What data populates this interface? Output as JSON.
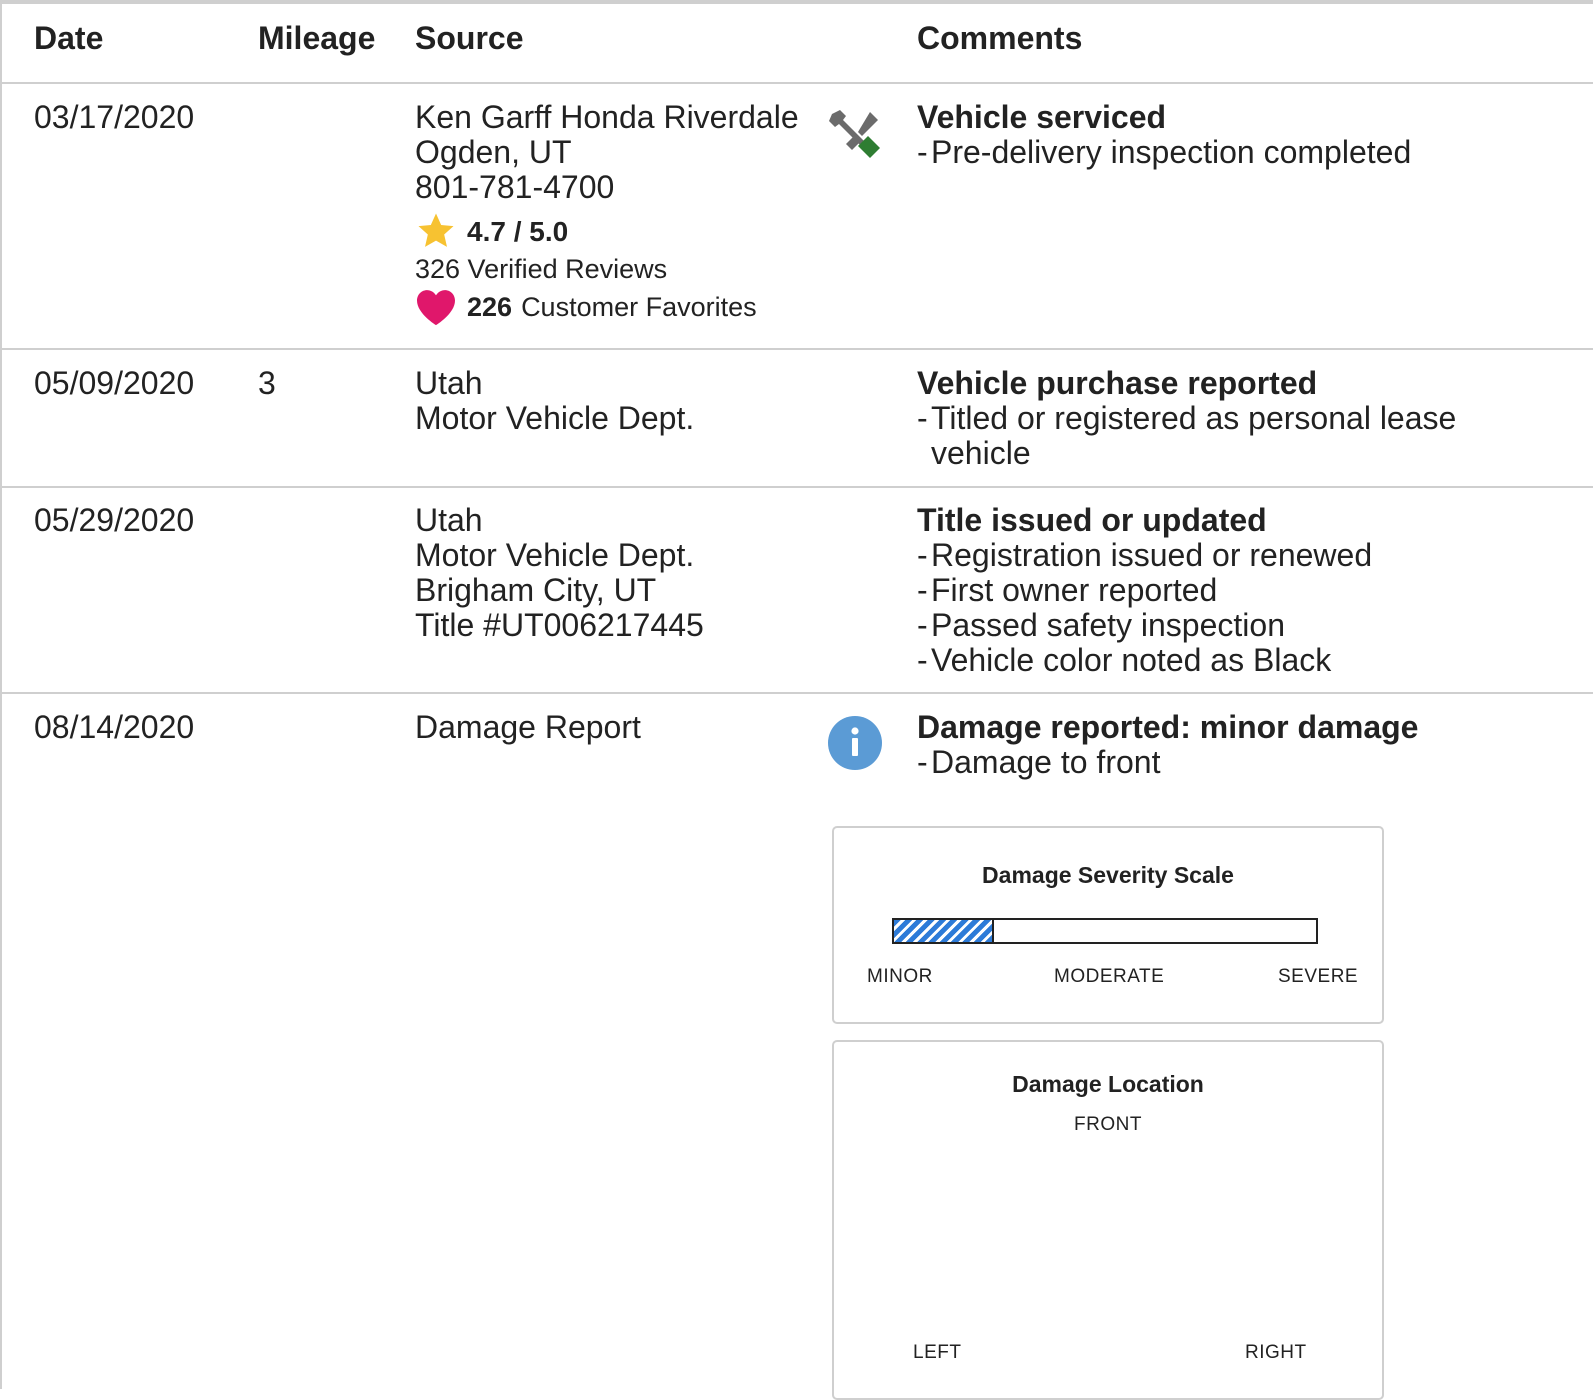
{
  "table": {
    "headers": {
      "date": "Date",
      "mileage": "Mileage",
      "source": "Source",
      "comments": "Comments"
    },
    "rows": [
      {
        "date": "03/17/2020",
        "mileage": "",
        "source": [
          "Ken Garff Honda Riverdale",
          "Ogden, UT",
          "801-781-4700"
        ],
        "rating": "4.7 / 5.0",
        "reviews": "326 Verified Reviews",
        "favorites_count": "226",
        "favorites_label": "Customer Favorites",
        "icon": "tools-icon",
        "comment_title": "Vehicle serviced",
        "comment_items": [
          "Pre-delivery inspection completed"
        ]
      },
      {
        "date": "05/09/2020",
        "mileage": "3",
        "source": [
          "Utah",
          "Motor Vehicle Dept."
        ],
        "comment_title": "Vehicle purchase reported",
        "comment_items": [
          "Titled or registered as personal lease vehicle"
        ]
      },
      {
        "date": "05/29/2020",
        "mileage": "",
        "source": [
          "Utah",
          "Motor Vehicle Dept.",
          "Brigham City, UT",
          "Title #UT006217445"
        ],
        "comment_title": "Title issued or updated",
        "comment_items": [
          "Registration issued or renewed",
          "First owner reported",
          "Passed safety inspection",
          "Vehicle color noted as Black"
        ]
      },
      {
        "date": "08/14/2020",
        "mileage": "",
        "source": [
          "Damage Report"
        ],
        "icon": "info-icon",
        "comment_title": "Damage reported: minor damage",
        "comment_items": [
          "Damage to front"
        ]
      }
    ]
  },
  "severity": {
    "title": "Damage Severity Scale",
    "labels": [
      "MINOR",
      "MODERATE",
      "SEVERE"
    ],
    "level_fraction": 0.24
  },
  "location": {
    "title": "Damage Location",
    "front": "FRONT",
    "left": "LEFT",
    "right": "RIGHT"
  },
  "colors": {
    "star": "#f7c231",
    "heart": "#e0176b",
    "info": "#5b9bd5",
    "tool_handle": "#2e7d32",
    "severity_fill": "#2d7bd8"
  }
}
